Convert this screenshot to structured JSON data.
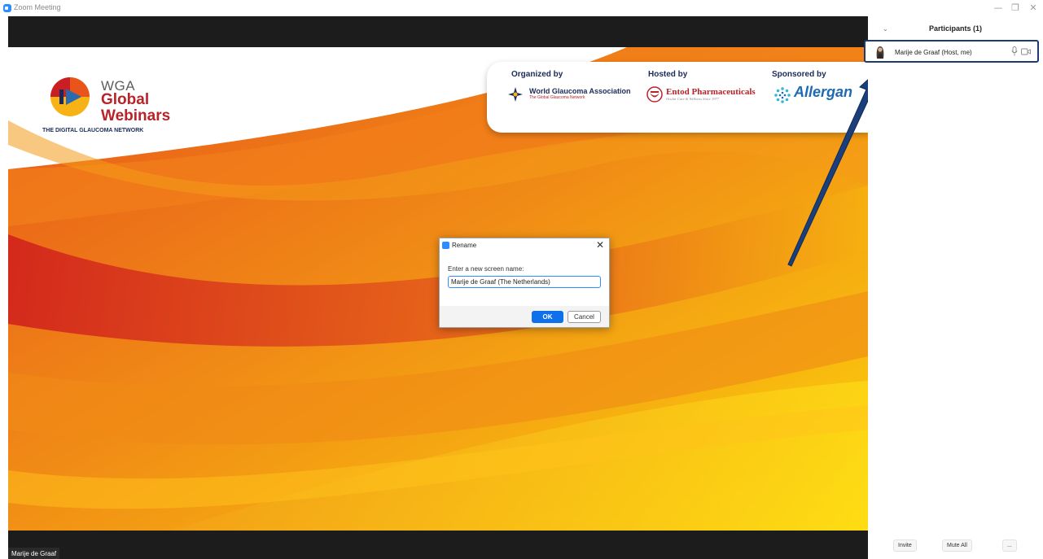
{
  "window": {
    "title": "Zoom Meeting",
    "controls": {
      "minimize": "—",
      "restore": "❐",
      "close": "✕"
    }
  },
  "video": {
    "participant_name_tag": "Marije de Graaf"
  },
  "slide": {
    "logo": {
      "line1": "WGA",
      "line2": "Global",
      "line3": "Webinars",
      "tagline": "THE DIGITAL GLAUCOMA NETWORK"
    },
    "sponsors": {
      "organized": {
        "heading": "Organized by",
        "name": "World Glaucoma Association",
        "sub": "The Global Glaucoma Network"
      },
      "hosted": {
        "heading": "Hosted by",
        "name": "Entod Pharmaceuticals",
        "sub": "Ocular Care & Wellness Since 1977"
      },
      "sponsored": {
        "heading": "Sponsored by",
        "name": "Allergan"
      }
    }
  },
  "dialog": {
    "title": "Rename",
    "close": "✕",
    "label": "Enter a new screen name:",
    "value": "Marije de Graaf (The Netherlands)",
    "ok": "OK",
    "cancel": "Cancel"
  },
  "participants": {
    "collapse": "⌄",
    "title": "Participants (1)",
    "list": [
      {
        "name": "Marije de Graaf (Host, me)"
      }
    ],
    "buttons": {
      "invite": "Invite",
      "mute_all": "Mute All",
      "more": "..."
    }
  },
  "colors": {
    "accent": "#2D8CFF",
    "ok_button": "#0e71eb",
    "highlight": "#1b3a72",
    "arrow": "#1b3f7a"
  }
}
